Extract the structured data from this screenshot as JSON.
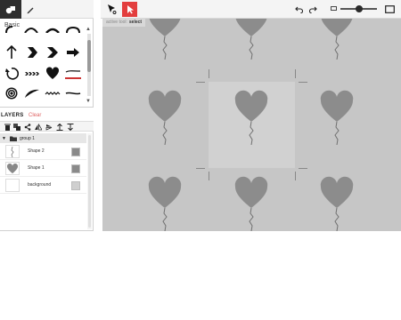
{
  "left_tabs": {
    "shapes_icon": "shapes-icon",
    "pen_icon": "pen-icon"
  },
  "library": {
    "title": "Basic",
    "shapes": [
      "curve-top-left",
      "curve-top-mid",
      "curve-top-right",
      "arrow-up",
      "chevron",
      "chevron-open",
      "arrow-right",
      "arrow-circle",
      "stripe-arrow",
      "heart",
      "brush-stroke",
      "spiral",
      "leaf",
      "zigzag",
      "brush-line"
    ]
  },
  "layers": {
    "title": "LAYERS",
    "clear_label": "Clear",
    "group_name": "group 1",
    "items": [
      {
        "name": "Shape 2",
        "swatch": "#8a8a8a"
      },
      {
        "name": "Shape 1",
        "swatch": "#8a8a8a"
      },
      {
        "name": "background",
        "swatch": "#cfcfcf"
      }
    ]
  },
  "toolbar": {
    "undo_icon": "undo-icon",
    "redo_icon": "redo-icon",
    "zoom_fraction": 0.5
  },
  "canvas": {
    "tool_label": "active tool:",
    "tool_name": "select",
    "background_color": "#c6c6c6",
    "page_color": "#d1d1d1",
    "balloon_color": "#8c8c8c"
  }
}
